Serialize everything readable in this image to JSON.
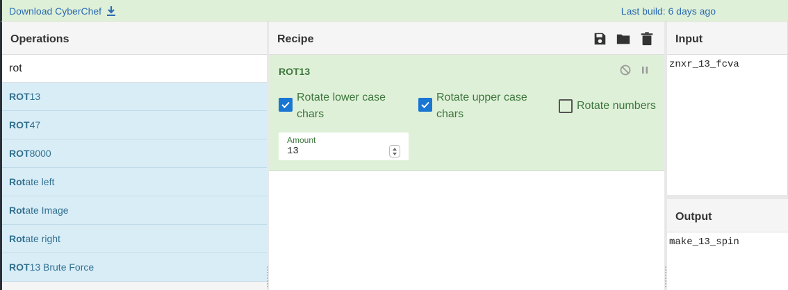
{
  "banner": {
    "download_label": "Download CyberChef",
    "last_build": "Last build: 6 days ago"
  },
  "operations": {
    "title": "Operations",
    "search_value": "rot",
    "items": [
      {
        "match": "ROT",
        "rest": "13"
      },
      {
        "match": "ROT",
        "rest": "47"
      },
      {
        "match": "ROT",
        "rest": "8000"
      },
      {
        "match": "Rot",
        "rest": "ate left"
      },
      {
        "match": "Rot",
        "rest": "ate Image"
      },
      {
        "match": "Rot",
        "rest": "ate right"
      },
      {
        "match": "ROT",
        "rest": "13 Brute Force"
      }
    ]
  },
  "recipe": {
    "title": "Recipe",
    "operation": {
      "name": "ROT13",
      "options": {
        "lower_label": "Rotate lower case chars",
        "lower_checked": true,
        "upper_label": "Rotate upper case chars",
        "upper_checked": true,
        "numbers_label": "Rotate numbers",
        "numbers_checked": false,
        "amount_label": "Amount",
        "amount_value": "13"
      }
    }
  },
  "input": {
    "title": "Input",
    "value": "znxr_13_fcva"
  },
  "output": {
    "title": "Output",
    "value": "make_13_spin"
  },
  "colors": {
    "banner_bg": "#dff0d8",
    "link": "#2b6bb3",
    "op_item_bg": "#d9edf7",
    "op_item_text": "#31708f",
    "recipe_card_bg": "#dff0d8",
    "recipe_text": "#3c763d",
    "checkbox_checked": "#1976d2"
  },
  "icons": [
    "download-icon",
    "save-icon",
    "folder-icon",
    "trash-icon",
    "disable-icon",
    "pause-icon"
  ]
}
